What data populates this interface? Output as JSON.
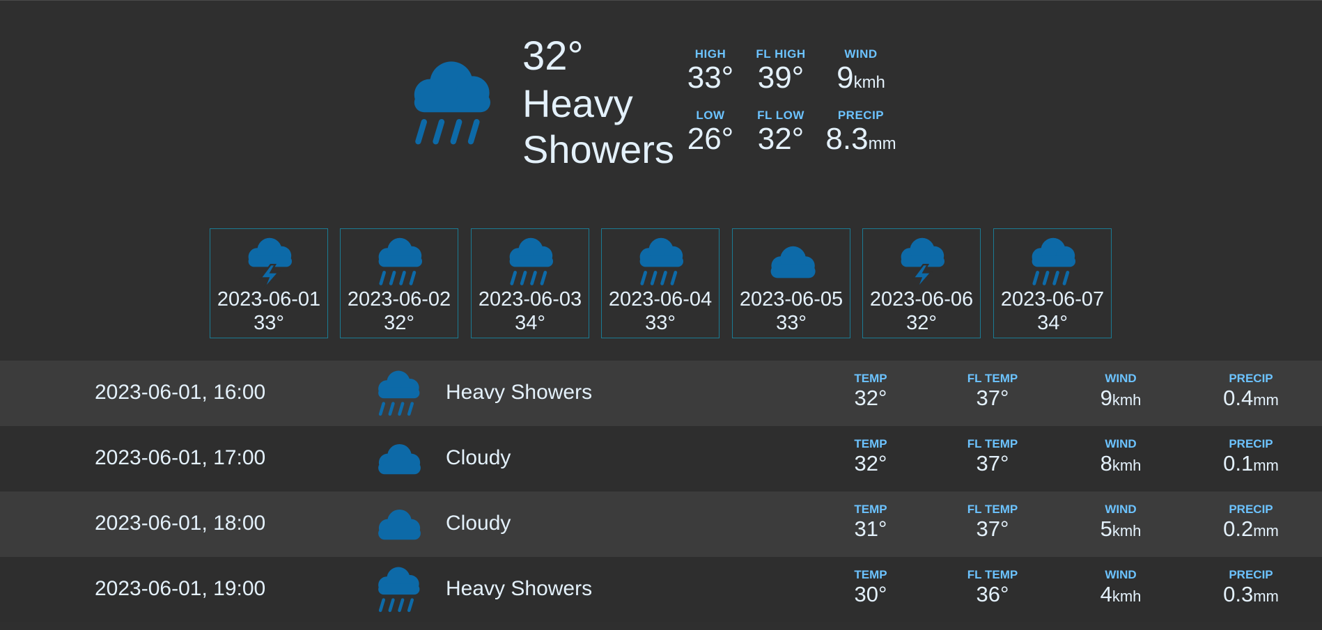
{
  "colors": {
    "icon": "#0d6aa8",
    "accent_label": "#6cc3ff",
    "border": "#1b7b94",
    "text": "#e4f1fb"
  },
  "current": {
    "icon": "heavy-rain-icon",
    "temp": "32°",
    "description": "Heavy Showers",
    "high_label": "HIGH",
    "high": "33°",
    "fl_high_label": "FL HIGH",
    "fl_high": "39°",
    "wind_label": "WIND",
    "wind": "9",
    "wind_unit": "kmh",
    "low_label": "LOW",
    "low": "26°",
    "fl_low_label": "FL LOW",
    "fl_low": "32°",
    "precip_label": "PRECIP",
    "precip": "8.3",
    "precip_unit": "mm"
  },
  "daily": [
    {
      "icon": "thunderstorm-icon",
      "date": "2023-06-01",
      "temp": "33°"
    },
    {
      "icon": "heavy-rain-icon",
      "date": "2023-06-02",
      "temp": "32°"
    },
    {
      "icon": "heavy-rain-icon",
      "date": "2023-06-03",
      "temp": "34°"
    },
    {
      "icon": "heavy-rain-icon",
      "date": "2023-06-04",
      "temp": "33°"
    },
    {
      "icon": "cloud-icon",
      "date": "2023-06-05",
      "temp": "33°"
    },
    {
      "icon": "thunderstorm-icon",
      "date": "2023-06-06",
      "temp": "32°"
    },
    {
      "icon": "heavy-rain-icon",
      "date": "2023-06-07",
      "temp": "34°"
    }
  ],
  "hourly_labels": {
    "temp": "TEMP",
    "fl_temp": "FL TEMP",
    "wind": "WIND",
    "precip": "PRECIP",
    "wind_unit": "kmh",
    "precip_unit": "mm"
  },
  "hourly": [
    {
      "time": "2023-06-01, 16:00",
      "icon": "heavy-rain-icon",
      "description": "Heavy Showers",
      "temp": "32°",
      "fl_temp": "37°",
      "wind": "9",
      "precip": "0.4"
    },
    {
      "time": "2023-06-01, 17:00",
      "icon": "cloud-icon",
      "description": "Cloudy",
      "temp": "32°",
      "fl_temp": "37°",
      "wind": "8",
      "precip": "0.1"
    },
    {
      "time": "2023-06-01, 18:00",
      "icon": "cloud-icon",
      "description": "Cloudy",
      "temp": "31°",
      "fl_temp": "37°",
      "wind": "5",
      "precip": "0.2"
    },
    {
      "time": "2023-06-01, 19:00",
      "icon": "heavy-rain-icon",
      "description": "Heavy Showers",
      "temp": "30°",
      "fl_temp": "36°",
      "wind": "4",
      "precip": "0.3"
    }
  ]
}
